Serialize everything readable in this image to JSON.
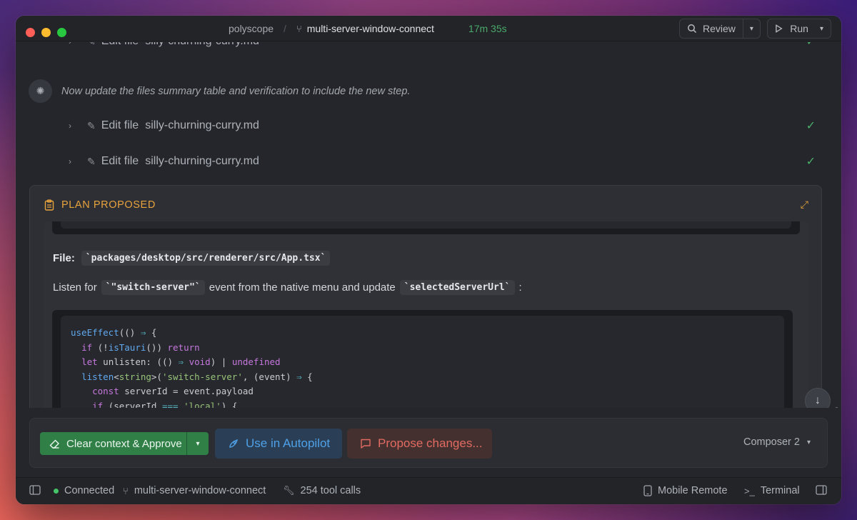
{
  "titlebar": {
    "project": "polyscope",
    "separator": "/",
    "branch": "multi-server-window-connect",
    "elapsed": "17m 35s",
    "review_label": "Review",
    "run_label": "Run"
  },
  "conversation": {
    "edit_rows": [
      {
        "action": "Edit file",
        "file": "silly-churning-curry.md"
      },
      {
        "action": "Edit file",
        "file": "silly-churning-curry.md"
      },
      {
        "action": "Edit file",
        "file": "silly-churning-curry.md"
      }
    ],
    "thought": "Now update the files summary table and verification to include the new step."
  },
  "plan": {
    "label": "PLAN PROPOSED",
    "file_label": "File:",
    "file_path": "`packages/desktop/src/renderer/src/App.tsx`",
    "para_before": "Listen for",
    "para_code1": "`\"switch-server\"`",
    "para_mid": "event from the native menu and update",
    "para_code2": "`selectedServerUrl`",
    "para_after": ":"
  },
  "actions": {
    "approve_label": "Clear context & Approve",
    "autopilot_label": "Use in Autopilot",
    "propose_label": "Propose changes...",
    "model_label": "Composer 2"
  },
  "status": {
    "connected_label": "Connected",
    "branch": "multi-server-window-connect",
    "tool_calls": "254 tool calls",
    "mobile_remote": "Mobile Remote",
    "terminal": "Terminal"
  },
  "colors": {
    "accent_orange": "#e8a33d",
    "approve_green": "#2f7f46",
    "autopilot_blue": "#4ea1e8",
    "propose_red": "#e26b62",
    "check_green": "#4caf6a"
  }
}
